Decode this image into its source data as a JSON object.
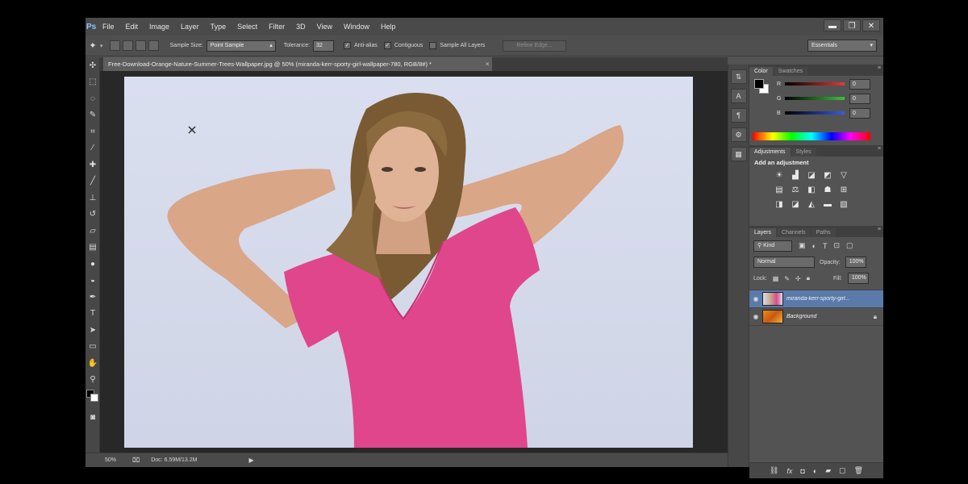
{
  "app": {
    "logo": "Ps"
  },
  "menu": [
    "File",
    "Edit",
    "Image",
    "Layer",
    "Type",
    "Select",
    "Filter",
    "3D",
    "View",
    "Window",
    "Help"
  ],
  "window_controls": {
    "minimize": "▬",
    "restore": "❐",
    "close": "✕"
  },
  "options_bar": {
    "sample_size_label": "Sample Size:",
    "sample_size_value": "Point Sample",
    "tolerance_label": "Tolerance:",
    "tolerance_value": "32",
    "anti_alias_label": "Anti-alias",
    "anti_alias_checked": true,
    "contiguous_label": "Contiguous",
    "contiguous_checked": true,
    "sample_all_layers_label": "Sample All Layers",
    "sample_all_layers_checked": false,
    "refine_edge_label": "Refine Edge...",
    "workspace": "Essentials"
  },
  "document": {
    "tab_title": "Free-Download-Orange-Nature-Summer-Trees-Wallpaper.jpg @ 50% (miranda-kerr-sporty-girl-wallpaper-780, RGB/8#) *",
    "tab_close": "×"
  },
  "status_bar": {
    "zoom": "50%",
    "doc_info": "Doc: 6.59M/13.2M"
  },
  "tools": [
    "move-tool",
    "marquee-tool",
    "lasso-tool",
    "quick-selection-tool",
    "crop-tool",
    "eyedropper-tool",
    "healing-brush-tool",
    "brush-tool",
    "clone-stamp-tool",
    "history-brush-tool",
    "eraser-tool",
    "gradient-tool",
    "blur-tool",
    "dodge-tool",
    "pen-tool",
    "type-tool",
    "path-selection-tool",
    "rectangle-tool",
    "hand-tool",
    "zoom-tool"
  ],
  "color_panel": {
    "tabs": [
      "Color",
      "Swatches"
    ],
    "active_tab": "Color",
    "channels": [
      {
        "label": "R",
        "value": "0",
        "color": "#e23a3a"
      },
      {
        "label": "G",
        "value": "0",
        "color": "#3ac23a"
      },
      {
        "label": "B",
        "value": "0",
        "color": "#3a5ae2"
      }
    ],
    "foreground": "#000000",
    "background": "#ffffff"
  },
  "adjustments_panel": {
    "tabs": [
      "Adjustments",
      "Styles"
    ],
    "active_tab": "Adjustments",
    "heading": "Add an adjustment"
  },
  "layers_panel": {
    "tabs": [
      "Layers",
      "Channels",
      "Paths"
    ],
    "active_tab": "Layers",
    "filter_kind": "Kind",
    "blend_mode": "Normal",
    "opacity_label": "Opacity:",
    "opacity_value": "100%",
    "lock_label": "Lock:",
    "fill_label": "Fill:",
    "fill_value": "100%",
    "layers": [
      {
        "name": "miranda-kerr-sporty-girl...",
        "visible": true,
        "selected": true,
        "locked": false
      },
      {
        "name": "Background",
        "visible": true,
        "selected": false,
        "locked": true
      }
    ]
  },
  "accent_color": "#5a7aaa"
}
